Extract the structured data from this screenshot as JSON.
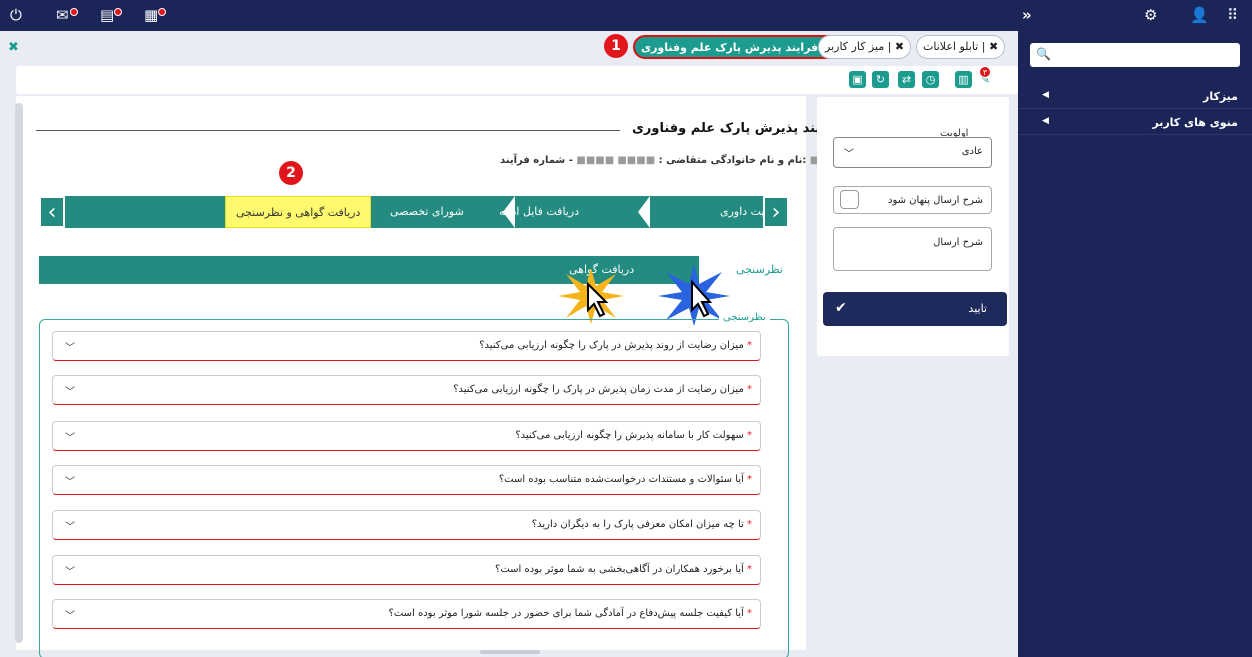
{
  "topbar": {
    "icons": [
      "power-icon",
      "mail-icon",
      "document-icon",
      "calendar-icon",
      "expand-icon",
      "gear-icon",
      "user-icon",
      "apps-grid-icon"
    ]
  },
  "sidebar": {
    "items": [
      {
        "label": "میزکار"
      },
      {
        "label": "منوی های کاربر"
      }
    ]
  },
  "tabs": [
    {
      "label": "فرایند پذیرش پارک علم وفناوری",
      "active": true
    },
    {
      "label": "میز کار کاربر",
      "active": false
    },
    {
      "label": "تابلو اعلانات",
      "active": false
    }
  ],
  "callouts": {
    "one": "1",
    "two": "2"
  },
  "toolbar": {
    "icons": [
      "save-icon",
      "refresh-icon",
      "route-icon",
      "history-icon",
      "chart-icon",
      "attachment-icon"
    ],
    "attachment_badge": "۳"
  },
  "page": {
    "title": "فرایند پذیرش پارک علم وفناوری",
    "applicant_label": "نام و نام خانوادگی متقاضی :",
    "applicant_value": "■■■■ ■■■■",
    "process_label": "- شماره فرآیند:",
    "process_value": "■■■"
  },
  "steps": [
    {
      "label": "سی کفایت داوری"
    },
    {
      "label": "دریافت فایل ارائه"
    },
    {
      "label": "شورای تخصصی"
    },
    {
      "label": "دریافت گواهی و نظرسنجی",
      "current": true
    }
  ],
  "subtabs": [
    {
      "label": "نظرسنجی"
    },
    {
      "label": "دریافت گواهی"
    }
  ],
  "survey": {
    "legend": "نظرسنجی",
    "questions": [
      "میزان رضایت از روند پذیرش در پارک را چگونه ارزیابی می‌کنید؟",
      "میزان رضایت از مدت زمان پذیرش در پارک را چگونه ارزیابی می‌کنید؟",
      "سهولت کار با سامانه پذیرش را چگونه ارزیابی می‌کنید؟",
      "آیا سئوالات و مستندات درخواست‌شده متناسب بوده است؟",
      "تا چه میزان امکان معرفی پارک را به دیگران دارید؟",
      "آیا برخورد همکاران در آگاهی‌بخشی به شما موثر بوده است؟",
      "آیا کیفیت جلسه پیش‌دفاع در آمادگی شما برای حضور در جلسه شورا موثر بوده است؟"
    ],
    "required_mark": "*"
  },
  "panel": {
    "priority_label": "اولویت",
    "priority_value": "عادی",
    "hide_label": "شرح ارسال پنهان شود",
    "desc_label": "شرح ارسال",
    "confirm_label": "تایید"
  },
  "colors": {
    "navy": "#1b2557",
    "teal": "#238b80",
    "highlight": "#fffa6e",
    "red": "#e0161c"
  }
}
